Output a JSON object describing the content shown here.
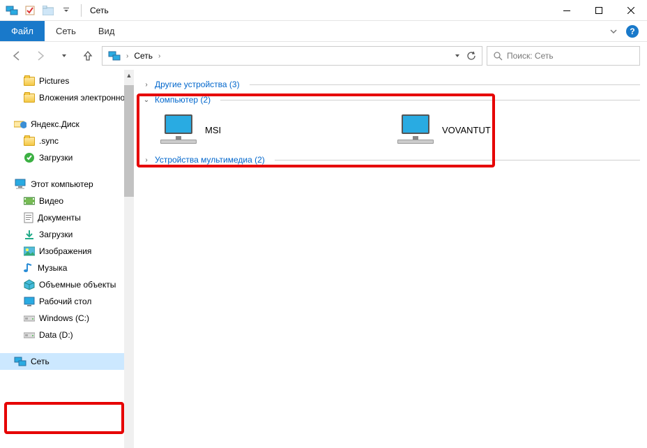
{
  "window": {
    "title": "Сеть"
  },
  "ribbon": {
    "file": "Файл",
    "tabs": [
      "Сеть",
      "Вид"
    ]
  },
  "toolbar": {
    "back_disabled": true,
    "forward_disabled": true
  },
  "address": {
    "location": "Сеть"
  },
  "search": {
    "placeholder": "Поиск: Сеть"
  },
  "sidebar": {
    "items": [
      {
        "label": "Pictures",
        "icon": "folder",
        "lvl": 1
      },
      {
        "label": "Вложения электронной почты",
        "icon": "folder",
        "lvl": 1
      },
      {
        "gap": true
      },
      {
        "label": "Яндекс.Диск",
        "icon": "yadisk",
        "lvl": 0
      },
      {
        "label": ".sync",
        "icon": "folder",
        "lvl": 1
      },
      {
        "label": "Загрузки",
        "icon": "sync",
        "lvl": 1
      },
      {
        "gap": true
      },
      {
        "label": "Этот компьютер",
        "icon": "pc",
        "lvl": 0
      },
      {
        "label": "Видео",
        "icon": "video",
        "lvl": 1
      },
      {
        "label": "Документы",
        "icon": "docs",
        "lvl": 1
      },
      {
        "label": "Загрузки",
        "icon": "download",
        "lvl": 1
      },
      {
        "label": "Изображения",
        "icon": "images",
        "lvl": 1
      },
      {
        "label": "Музыка",
        "icon": "music",
        "lvl": 1
      },
      {
        "label": "Объемные объекты",
        "icon": "cube",
        "lvl": 1
      },
      {
        "label": "Рабочий стол",
        "icon": "desktop",
        "lvl": 1
      },
      {
        "label": "Windows (C:)",
        "icon": "drive",
        "lvl": 1
      },
      {
        "label": "Data (D:)",
        "icon": "drive",
        "lvl": 1
      },
      {
        "gap": true
      },
      {
        "label": "Сеть",
        "icon": "network",
        "lvl": 0,
        "selected": true
      }
    ]
  },
  "content": {
    "groups": [
      {
        "label": "Другие устройства",
        "count": 3,
        "expanded": false,
        "items": []
      },
      {
        "label": "Компьютер",
        "count": 2,
        "expanded": true,
        "items": [
          {
            "name": "MSI"
          },
          {
            "name": "VOVANTUT"
          }
        ]
      },
      {
        "label": "Устройства мультимедиа",
        "count": 2,
        "expanded": false,
        "items": []
      }
    ]
  }
}
